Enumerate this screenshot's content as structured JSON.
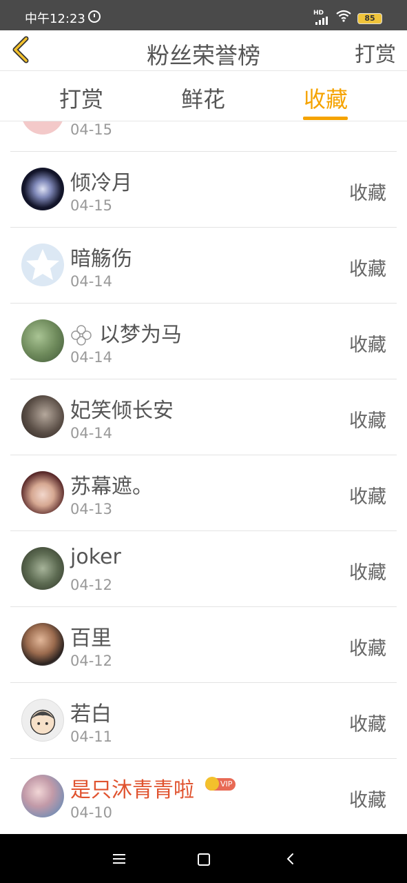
{
  "status": {
    "time": "中午12:23",
    "network": "HD",
    "battery": "85"
  },
  "header": {
    "title": "粉丝荣誉榜",
    "right_action": "打赏"
  },
  "tabs": [
    {
      "label": "打赏",
      "active": false
    },
    {
      "label": "鲜花",
      "active": false
    },
    {
      "label": "收藏",
      "active": true
    }
  ],
  "colors": {
    "accent": "#f5a300",
    "vip_name": "#e0532f"
  },
  "list": {
    "partial_row": {
      "date": "04-15"
    },
    "rows": [
      {
        "name": "倾冷月",
        "date": "04-15",
        "action": "收藏"
      },
      {
        "name": "暗觞伤",
        "date": "04-14",
        "action": "收藏"
      },
      {
        "name": "以梦为马",
        "date": "04-14",
        "action": "收藏"
      },
      {
        "name": "妃笑倾长安",
        "date": "04-14",
        "action": "收藏"
      },
      {
        "name": "苏幕遮。",
        "date": "04-13",
        "action": "收藏"
      },
      {
        "name": "joker",
        "date": "04-12",
        "action": "收藏"
      },
      {
        "name": "百里",
        "date": "04-12",
        "action": "收藏"
      },
      {
        "name": "若白",
        "date": "04-11",
        "action": "收藏"
      },
      {
        "name": "是只沐青青啦",
        "date": "04-10",
        "action": "收藏",
        "vip": "VIP"
      }
    ]
  }
}
